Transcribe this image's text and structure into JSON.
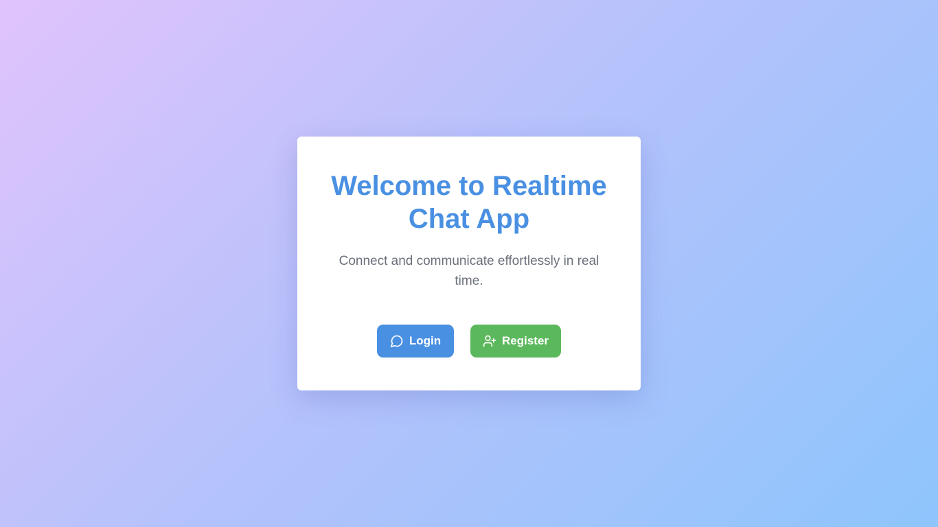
{
  "welcome": {
    "title": "Welcome to Realtime Chat App",
    "subtitle": "Connect and communicate effortlessly in real time."
  },
  "actions": {
    "login_label": "Login",
    "login_icon": "chat-bubble-icon",
    "register_label": "Register",
    "register_icon": "user-plus-icon"
  },
  "colors": {
    "primary": "#4a90e2",
    "success": "#5cb85c",
    "text_muted": "#6b6f7b",
    "card_bg": "#ffffff"
  }
}
